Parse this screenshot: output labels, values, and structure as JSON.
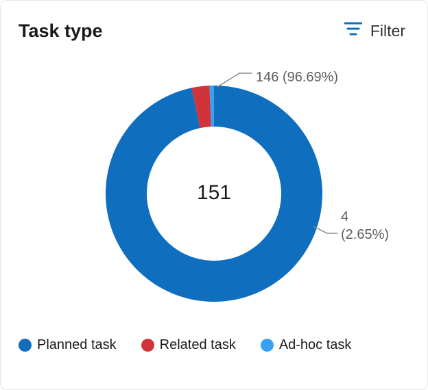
{
  "title": "Task type",
  "filter_label": "Filter",
  "total": "151",
  "colors": {
    "planned": "#106ebe",
    "related": "#d13438",
    "adhoc": "#3aa0f3"
  },
  "legend": {
    "planned": "Planned task",
    "related": "Related task",
    "adhoc": "Ad-hoc task"
  },
  "callouts": {
    "top": "146 (96.69%)",
    "side_line1": "4",
    "side_line2": "(2.65%)"
  },
  "chart_data": {
    "type": "pie",
    "title": "Task type",
    "total": 151,
    "series": [
      {
        "name": "Planned task",
        "value": 146,
        "percent": 96.69,
        "color": "#106ebe"
      },
      {
        "name": "Related task",
        "value": 4,
        "percent": 2.65,
        "color": "#d13438"
      },
      {
        "name": "Ad-hoc task",
        "value": 1,
        "percent": 0.66,
        "color": "#3aa0f3"
      }
    ],
    "annotations": [
      "146 (96.69%)",
      "4 (2.65%)"
    ]
  }
}
